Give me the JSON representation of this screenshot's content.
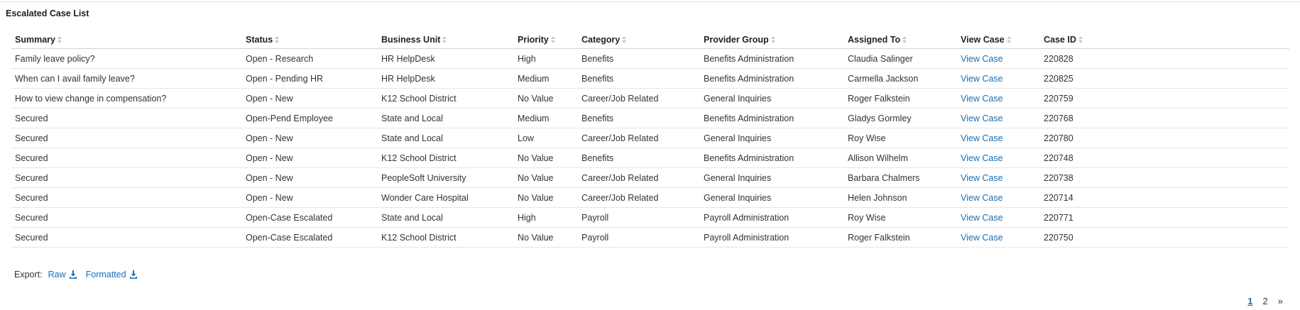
{
  "panel": {
    "title": "Escalated Case List"
  },
  "table": {
    "headers": [
      "Summary",
      "Status",
      "Business Unit",
      "Priority",
      "Category",
      "Provider Group",
      "Assigned To",
      "View Case",
      "Case ID"
    ],
    "rows": [
      [
        "Family leave policy?",
        "Open - Research",
        "HR HelpDesk",
        "High",
        "Benefits",
        "Benefits Administration",
        "Claudia Salinger",
        "View Case",
        "220828"
      ],
      [
        "When can I avail family leave?",
        "Open - Pending HR",
        "HR HelpDesk",
        "Medium",
        "Benefits",
        "Benefits Administration",
        "Carmella Jackson",
        "View Case",
        "220825"
      ],
      [
        "How to view change in compensation?",
        "Open - New",
        "K12 School District",
        "No Value",
        "Career/Job Related",
        "General Inquiries",
        "Roger Falkstein",
        "View Case",
        "220759"
      ],
      [
        "Secured",
        "Open-Pend Employee",
        "State and Local",
        "Medium",
        "Benefits",
        "Benefits Administration",
        "Gladys Gormley",
        "View Case",
        "220768"
      ],
      [
        "Secured",
        "Open - New",
        "State and Local",
        "Low",
        "Career/Job Related",
        "General Inquiries",
        "Roy Wise",
        "View Case",
        "220780"
      ],
      [
        "Secured",
        "Open - New",
        "K12 School District",
        "No Value",
        "Benefits",
        "Benefits Administration",
        "Allison Wilhelm",
        "View Case",
        "220748"
      ],
      [
        "Secured",
        "Open - New",
        "PeopleSoft University",
        "No Value",
        "Career/Job Related",
        "General Inquiries",
        "Barbara Chalmers",
        "View Case",
        "220738"
      ],
      [
        "Secured",
        "Open - New",
        "Wonder Care Hospital",
        "No Value",
        "Career/Job Related",
        "General Inquiries",
        "Helen Johnson",
        "View Case",
        "220714"
      ],
      [
        "Secured",
        "Open-Case Escalated",
        "State and Local",
        "High",
        "Payroll",
        "Payroll Administration",
        "Roy Wise",
        "View Case",
        "220771"
      ],
      [
        "Secured",
        "Open-Case Escalated",
        "K12 School District",
        "No Value",
        "Payroll",
        "Payroll Administration",
        "Roger Falkstein",
        "View Case",
        "220750"
      ]
    ]
  },
  "export": {
    "label": "Export:",
    "raw": "Raw",
    "formatted": "Formatted",
    "icon": "download-icon"
  },
  "pagination": {
    "pages": [
      "1",
      "2"
    ],
    "current": "1",
    "next": "»"
  },
  "colors": {
    "link": "#1a6fb3",
    "text": "#333333",
    "border": "#e3e6ea"
  }
}
